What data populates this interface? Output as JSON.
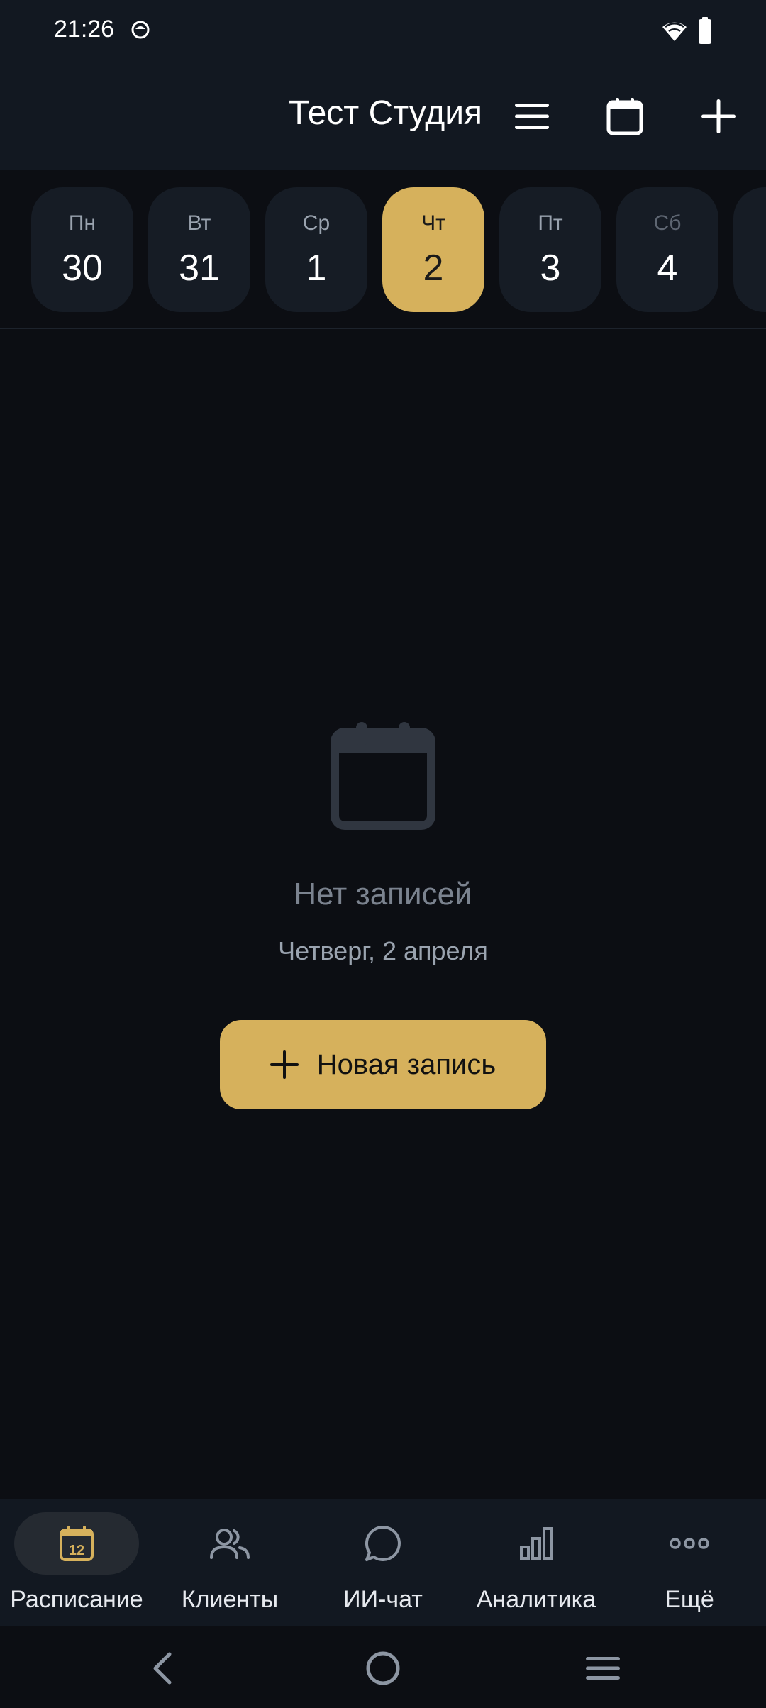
{
  "status_bar": {
    "time": "21:26",
    "icons": [
      "app-notification-icon",
      "wifi-icon",
      "battery-icon"
    ]
  },
  "header": {
    "title": "Тест Студия",
    "icons": [
      "menu-icon",
      "calendar-icon",
      "plus-icon"
    ]
  },
  "week": {
    "days": [
      {
        "weekday": "Пн",
        "number": "30"
      },
      {
        "weekday": "Вт",
        "number": "31"
      },
      {
        "weekday": "Ср",
        "number": "1"
      },
      {
        "weekday": "Чт",
        "number": "2",
        "selected": true
      },
      {
        "weekday": "Пт",
        "number": "3"
      },
      {
        "weekday": "Сб",
        "number": "4"
      }
    ]
  },
  "empty_state": {
    "icon": "calendar-icon",
    "title": "Нет записей",
    "subtitle": "Четверг, 2 апреля",
    "button_label": "Новая запись"
  },
  "bottom_nav": {
    "items": [
      {
        "label": "Расписание",
        "icon": "calendar-12-icon",
        "active": true
      },
      {
        "label": "Клиенты",
        "icon": "users-icon"
      },
      {
        "label": "ИИ-чат",
        "icon": "chat-bubble-icon"
      },
      {
        "label": "Аналитика",
        "icon": "bar-chart-icon"
      },
      {
        "label": "Ещё",
        "icon": "more-dots-icon"
      }
    ],
    "calendar_badge": "12"
  },
  "system_nav": {
    "icons": [
      "back-icon",
      "home-icon",
      "recents-icon"
    ]
  },
  "colors": {
    "background": "#0c0e13",
    "surface": "#121821",
    "card": "#161c25",
    "accent": "#d6b15c",
    "muted_text": "#9aa3af"
  }
}
